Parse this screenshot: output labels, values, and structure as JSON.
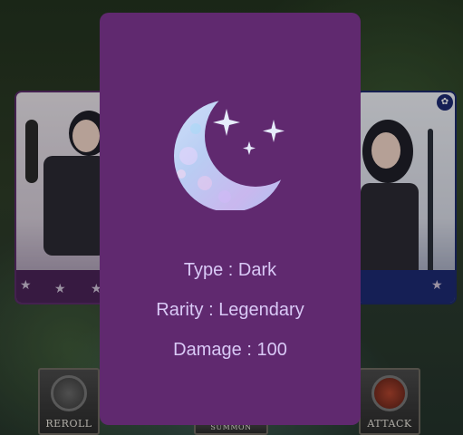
{
  "background": {
    "left_card": {
      "element_color": "#5b2d6a"
    },
    "right_card": {
      "element_color": "#1d2a6b"
    },
    "buttons": {
      "reroll": "REROLL",
      "summon": "SUMMON",
      "attack": "ATTACK"
    }
  },
  "element_card": {
    "icon": "crescent-moon-with-sparkles-icon",
    "background_color": "#60296f",
    "text_color": "#d9c9f6",
    "type_label": "Type",
    "type_value": "Dark",
    "rarity_label": "Rarity",
    "rarity_value": "Legendary",
    "damage_label": "Damage",
    "damage_value": "100",
    "separator": ":"
  }
}
